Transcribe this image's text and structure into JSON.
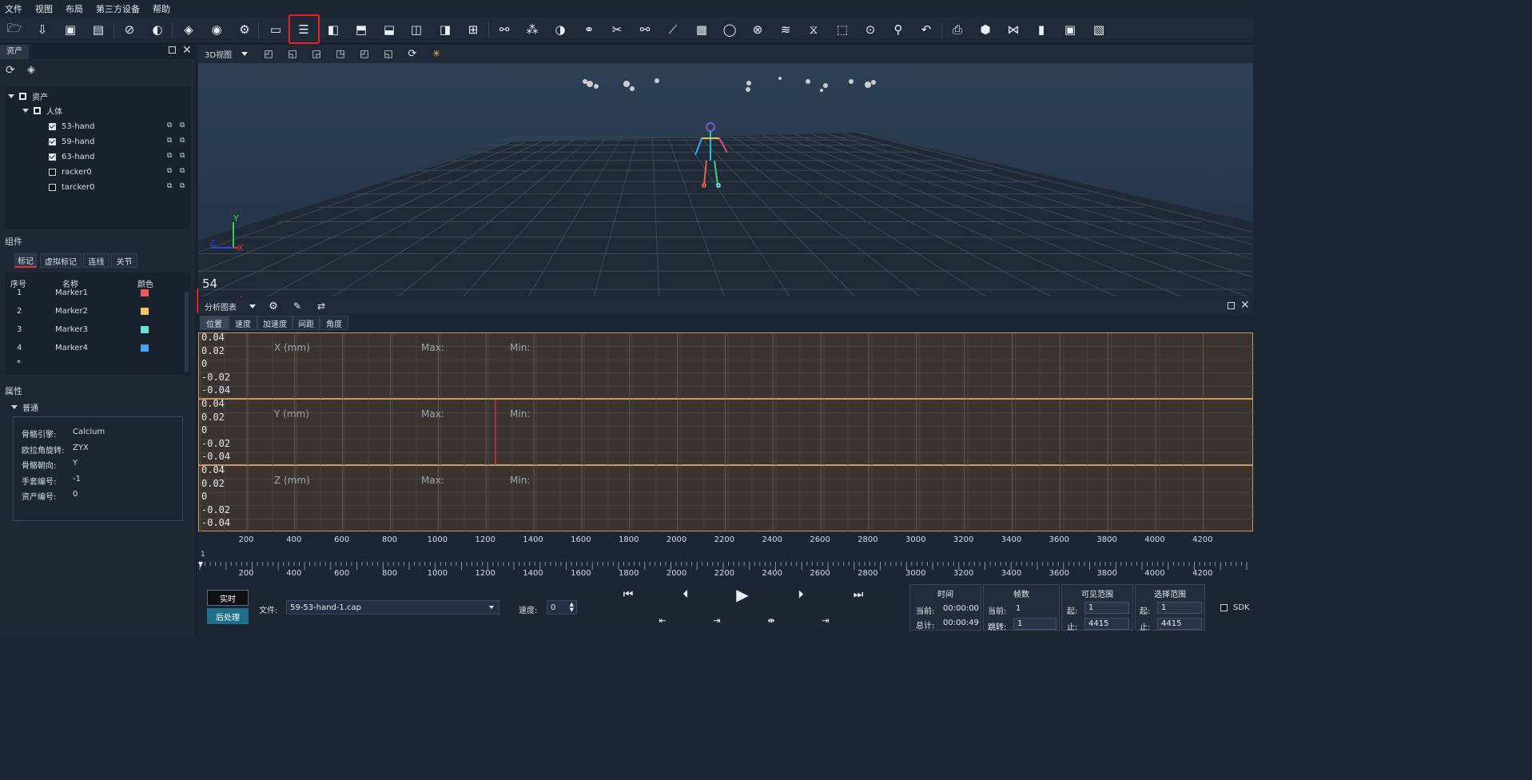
{
  "menu": [
    "文件",
    "视图",
    "布局",
    "第三方设备",
    "帮助"
  ],
  "toolbar_icons": [
    "folder-open-icon",
    "download-icon",
    "save-as-icon",
    "save-icon",
    "hide-icon",
    "record-icon",
    "layers-icon",
    "wifi-icon",
    "settings-icon",
    "layout-single-icon",
    "layout-split-horizontal-icon",
    "layout-left-split-icon",
    "layout-top-split-icon",
    "layout-bottom-split-icon",
    "layout-three-icon",
    "layout-right-split-icon",
    "layout-quad-icon",
    "marker-link-icon",
    "marker-group-icon",
    "marker-swap-icon",
    "marker-fill-icon",
    "cut-icon",
    "link-icon",
    "unlink-icon",
    "calculator-icon",
    "bulb-icon",
    "crosshair-icon",
    "wave-icon",
    "filter-icon",
    "select-box-icon",
    "rotate-target-icon",
    "run-icon",
    "undo-icon",
    "export-icon",
    "3d-icon",
    "share-icon",
    "chart-bar-icon",
    "vm-icon",
    "document-icon"
  ],
  "assets_panel": {
    "tab": "资产",
    "tree": {
      "root": "资产",
      "group": "人体",
      "items": [
        {
          "label": "53-hand",
          "checked": true
        },
        {
          "label": "59-hand",
          "checked": true
        },
        {
          "label": "63-hand",
          "checked": true
        },
        {
          "label": "racker0",
          "checked": false
        },
        {
          "label": "tarcker0",
          "checked": false
        }
      ]
    }
  },
  "components": {
    "title": "组件",
    "tabs": [
      "标记",
      "虚拟标记",
      "连线",
      "关节"
    ],
    "columns": [
      "序号",
      "名称",
      "颜色"
    ],
    "rows": [
      {
        "idx": "1",
        "name": "Marker1",
        "color": "#e85c5c"
      },
      {
        "idx": "2",
        "name": "Marker2",
        "color": "#f2c46a"
      },
      {
        "idx": "3",
        "name": "Marker3",
        "color": "#6de0d8"
      },
      {
        "idx": "4",
        "name": "Marker4",
        "color": "#4e9ff0"
      }
    ],
    "new_row": "*"
  },
  "properties": {
    "title": "属性",
    "section": "普通",
    "items": [
      {
        "key": "骨骼引擎:",
        "value": "Calcium"
      },
      {
        "key": "欧拉角旋转:",
        "value": "ZYX"
      },
      {
        "key": "骨骼朝向:",
        "value": "Y"
      },
      {
        "key": "手套编号:",
        "value": "-1"
      },
      {
        "key": "资产编号:",
        "value": "0"
      }
    ]
  },
  "viewport": {
    "view_select": "3D视图",
    "frame_number": "54",
    "axis_y": "Y",
    "axis_z": "Z",
    "axis_x": "X"
  },
  "analysis": {
    "select": "分析图表",
    "tabs": [
      "位置",
      "速度",
      "加速度",
      "间距",
      "角度"
    ],
    "plots": [
      {
        "label": "X (mm)",
        "max": "Max:",
        "min": "Min:"
      },
      {
        "label": "Y (mm)",
        "max": "Max:",
        "min": "Min:"
      },
      {
        "label": "Z (mm)",
        "max": "Max:",
        "min": "Min:"
      }
    ],
    "y_ticks": [
      "0.04",
      "0.02",
      "0",
      "-0.02",
      "-0.04"
    ],
    "x_ticks": [
      "200",
      "400",
      "600",
      "800",
      "1000",
      "1200",
      "1400",
      "1600",
      "1800",
      "2000",
      "2200",
      "2400",
      "2600",
      "2800",
      "3000",
      "3200",
      "3400",
      "3600",
      "3800",
      "4000",
      "4200"
    ]
  },
  "timeline": {
    "start": "1",
    "ticks": [
      "200",
      "400",
      "600",
      "800",
      "1000",
      "1200",
      "1400",
      "1600",
      "1800",
      "2000",
      "2200",
      "2400",
      "2600",
      "2800",
      "3000",
      "3200",
      "3400",
      "3600",
      "3800",
      "4000",
      "4200"
    ]
  },
  "bottom": {
    "realtime": "实时",
    "postprocess": "后处理",
    "file_label": "文件:",
    "file_value": "59-53-hand-1.cap",
    "speed_label": "速度:",
    "speed_value": "0",
    "time": {
      "title": "时间",
      "current_label": "当前:",
      "current": "00:00:00",
      "total_label": "总计:",
      "total": "00:00:49"
    },
    "frames": {
      "title": "帧数",
      "current_label": "当前:",
      "current": "1",
      "jump_label": "跳转:",
      "jump": "1"
    },
    "visible": {
      "title": "可见范围",
      "start_label": "起:",
      "start": "1",
      "end_label": "止:",
      "end": "4415"
    },
    "selection": {
      "title": "选择范围",
      "start_label": "起:",
      "start": "1",
      "end_label": "止:",
      "end": "4415"
    },
    "sdk": "SDK"
  }
}
